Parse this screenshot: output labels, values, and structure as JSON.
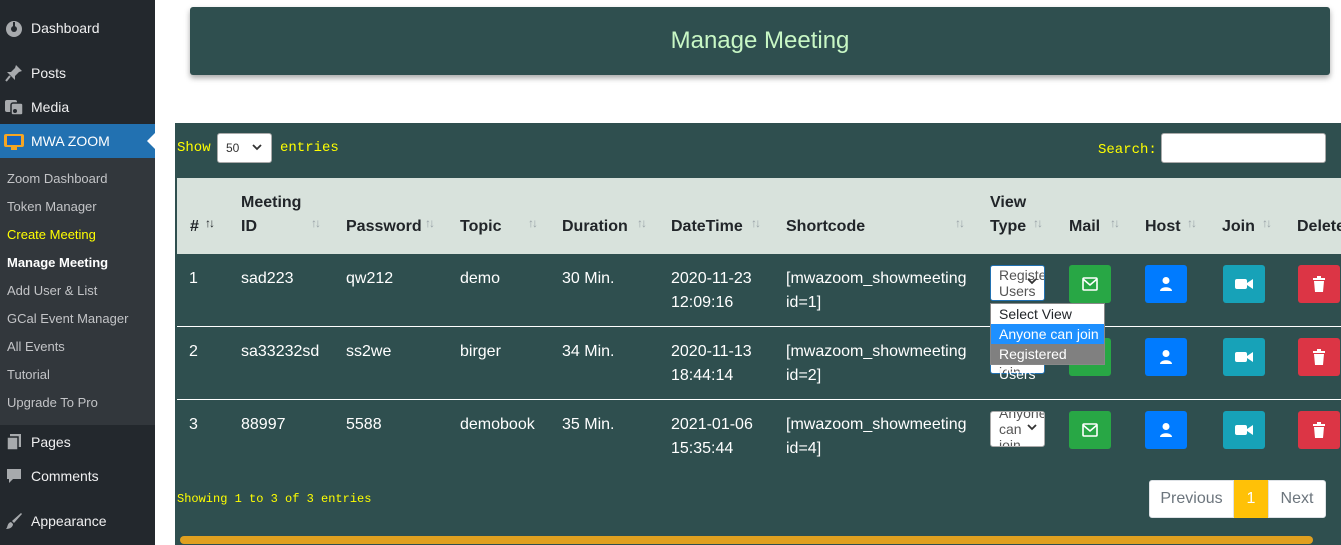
{
  "sidebar": {
    "items": [
      {
        "label": "Dashboard",
        "icon": "dashboard-icon"
      },
      {
        "label": "Posts",
        "icon": "pin-icon"
      },
      {
        "label": "Media",
        "icon": "media-icon"
      },
      {
        "label": "MWA ZOOM",
        "icon": "zoom-plugin-icon"
      },
      {
        "label": "Pages",
        "icon": "pages-icon"
      },
      {
        "label": "Comments",
        "icon": "comment-icon"
      },
      {
        "label": "Appearance",
        "icon": "brush-icon"
      }
    ],
    "submenu": [
      "Zoom Dashboard",
      "Token Manager",
      "Create Meeting",
      "Manage Meeting",
      "Add User & List",
      "GCal Event Manager",
      "All Events",
      "Tutorial",
      "Upgrade To Pro"
    ]
  },
  "header": {
    "title": "Manage Meeting"
  },
  "table_controls": {
    "show": "Show",
    "entries_value": "50",
    "entries": "entries",
    "search_label": "Search:"
  },
  "columns": {
    "num": "#",
    "meeting_id_1": "Meeting",
    "meeting_id_2": "ID",
    "password": "Password",
    "topic": "Topic",
    "duration": "Duration",
    "datetime": "DateTime",
    "shortcode": "Shortcode",
    "view_type_1": "View",
    "view_type_2": "Type",
    "mail": "Mail",
    "host": "Host",
    "join": "Join",
    "delete": "Delete"
  },
  "rows": [
    {
      "num": "1",
      "meeting_id": "sad223",
      "password": "qw212",
      "topic": "demo",
      "duration": "30 Min.",
      "date": "2020-11-23",
      "time": "12:09:16",
      "shortcode_1": "[mwazoom_showmeeting",
      "shortcode_2": "id=1]",
      "view_type": "Registered Users"
    },
    {
      "num": "2",
      "meeting_id": "sa33232sd",
      "password": "ss2we",
      "topic": "birger",
      "duration": "34 Min.",
      "date": "2020-11-13",
      "time": "18:44:14",
      "shortcode_1": "[mwazoom_showmeeting",
      "shortcode_2": "id=2]",
      "view_type": "Anyone can join"
    },
    {
      "num": "3",
      "meeting_id": "88997",
      "password": "5588",
      "topic": "demobook",
      "duration": "35 Min.",
      "date": "2021-01-06",
      "time": "15:35:44",
      "shortcode_1": "[mwazoom_showmeeting",
      "shortcode_2": "id=4]",
      "view_type": "Anyone can join"
    }
  ],
  "view_type_options": [
    "Select View",
    "Anyone can join",
    "Registered Users"
  ],
  "footer": {
    "info": "Showing 1 to 3 of 3 entries",
    "previous": "Previous",
    "page": "1",
    "next": "Next"
  },
  "colors": {
    "panel": "#2f4f4f",
    "accent_text": "#ffff00",
    "mail": "#28a745",
    "host": "#007bff",
    "join": "#17a2b8",
    "delete": "#dc3545",
    "active_page": "#ffc107"
  }
}
